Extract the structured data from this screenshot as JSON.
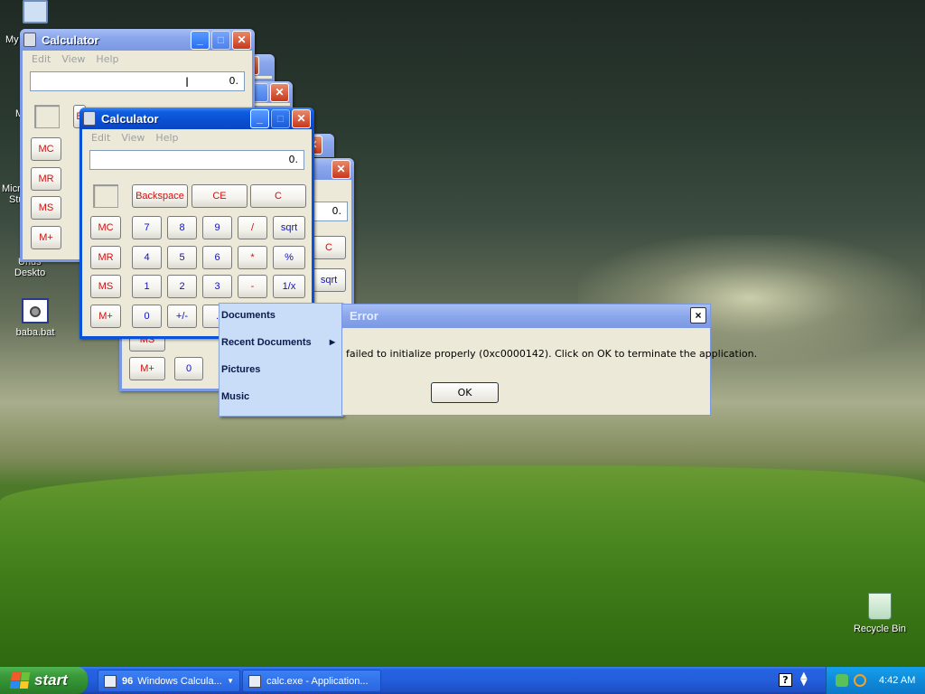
{
  "desktop": {
    "icons": [
      {
        "label": "baba.bat",
        "icon": "batch-file-icon"
      },
      {
        "label": "Recycle Bin",
        "icon": "recycle-bin-icon"
      }
    ],
    "partial_labels": [
      "My",
      "M",
      "Micro",
      "Stu",
      "Unus",
      "Deskto"
    ]
  },
  "calc_back": {
    "title": "Calculator",
    "menu": [
      "Edit",
      "View",
      "Help"
    ],
    "display": "0.",
    "mem_buttons": [
      "MC",
      "MR",
      "MS",
      "M+"
    ],
    "partial_buttons": [
      "B"
    ]
  },
  "calc_front": {
    "title": "Calculator",
    "menu": [
      "Edit",
      "View",
      "Help"
    ],
    "display": "0.",
    "top_buttons": [
      "Backspace",
      "CE",
      "C"
    ],
    "mem_buttons": [
      "MC",
      "MR",
      "MS",
      "M+"
    ],
    "rows": [
      [
        "7",
        "8",
        "9",
        "/",
        "sqrt"
      ],
      [
        "4",
        "5",
        "6",
        "*",
        "%"
      ],
      [
        "1",
        "2",
        "3",
        "-",
        "1/x"
      ],
      [
        "0",
        "+/-",
        "."
      ]
    ]
  },
  "calc_lower": {
    "display": "0.",
    "visible_buttons": [
      "C",
      "sqrt",
      "MS",
      "M+",
      "0"
    ]
  },
  "context_menu": {
    "items": [
      "Documents",
      "Recent Documents",
      "Pictures",
      "Music"
    ]
  },
  "error_dialog": {
    "title": "Error",
    "message": "failed to initialize properly (0xc0000142). Click on OK to terminate the application.",
    "ok": "OK",
    "close": "×"
  },
  "taskbar": {
    "start": "start",
    "group_count": "96",
    "group_label": "Windows Calcula...",
    "second_label": "calc.exe - Application...",
    "clock": "4:42 AM"
  },
  "colors": {
    "xp_blue": "#0a52d8",
    "start_green": "#3c9b3c",
    "tray_blue": "#0f8ad8"
  }
}
